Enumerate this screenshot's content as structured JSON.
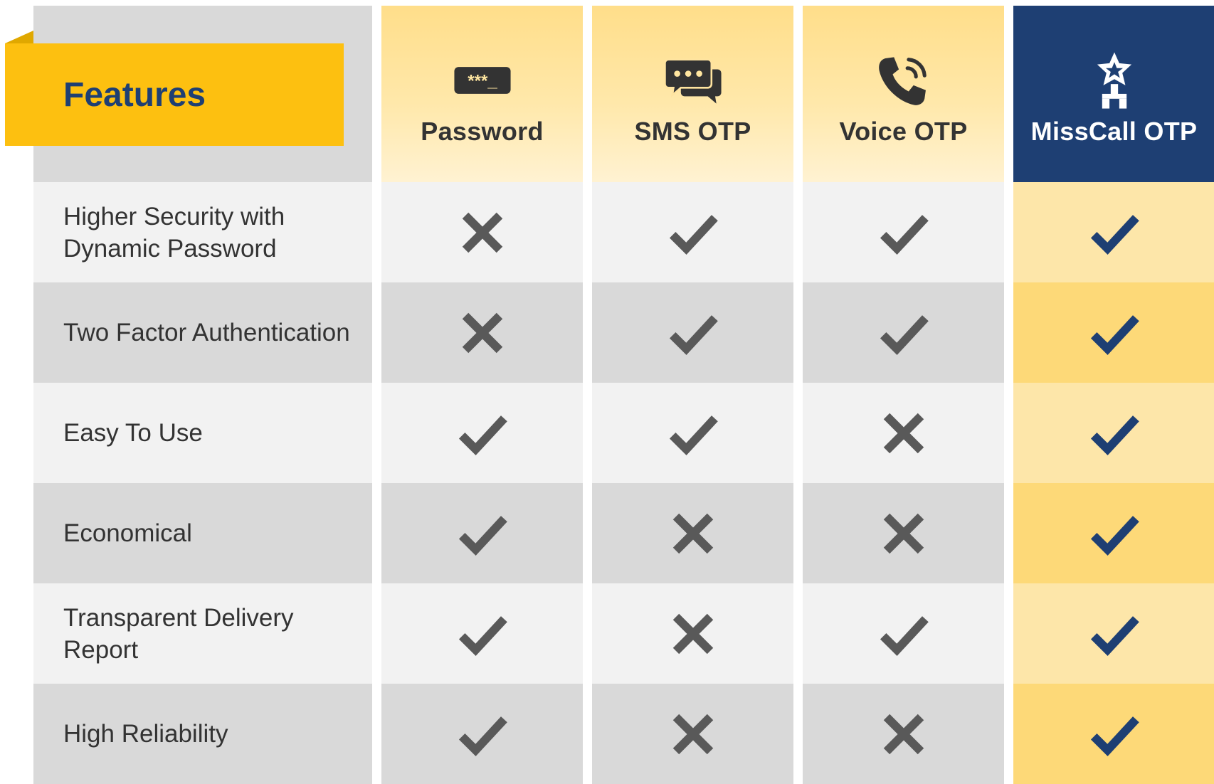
{
  "header": {
    "features_label": "Features",
    "columns": [
      {
        "label": "Password",
        "icon": "password-field-icon",
        "highlight": false
      },
      {
        "label": "SMS OTP",
        "icon": "chat-bubbles-icon",
        "highlight": false
      },
      {
        "label": "Voice OTP",
        "icon": "phone-call-icon",
        "highlight": false
      },
      {
        "label": "MissCall OTP",
        "icon": "trophy-star-icon",
        "highlight": true
      }
    ]
  },
  "password_icon_text": "***_",
  "rows": [
    {
      "feature": "Higher Security with Dynamic Password",
      "marks": [
        "cross",
        "check",
        "check",
        "check"
      ]
    },
    {
      "feature": "Two Factor Authentication",
      "marks": [
        "cross",
        "check",
        "check",
        "check"
      ]
    },
    {
      "feature": "Easy To Use",
      "marks": [
        "check",
        "check",
        "cross",
        "check"
      ]
    },
    {
      "feature": "Economical",
      "marks": [
        "check",
        "cross",
        "cross",
        "check"
      ]
    },
    {
      "feature": "Transparent Delivery Report",
      "marks": [
        "check",
        "cross",
        "check",
        "check"
      ]
    },
    {
      "feature": "High Reliability",
      "marks": [
        "check",
        "cross",
        "cross",
        "check"
      ]
    }
  ],
  "colors": {
    "accent_yellow": "#fdc010",
    "navy": "#1e3f73",
    "mark_gray": "#595959",
    "header_yellow": "#ffde8a",
    "highlight_light": "#fde6a9",
    "highlight_dark": "#fdd978"
  }
}
